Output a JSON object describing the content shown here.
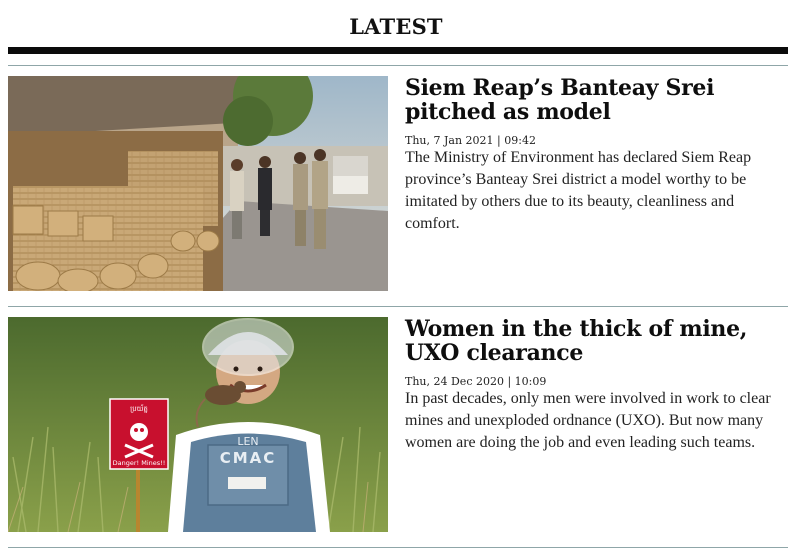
{
  "section": {
    "title": "LATEST"
  },
  "articles": [
    {
      "headline": "Siem Reap’s Banteay Srei pitched as model",
      "date": "Thu, 7 Jan 2021 | 09:42",
      "summary": "The Ministry of Environment has declared Siem Reap province’s Banteay Srei district a model worthy to be imitated by others due to its beauty, cleanliness and comfort.",
      "image_alt": "Officials visiting a roadside stall of woven rattan baskets"
    },
    {
      "headline": "Women in the thick of mine, UXO clearance",
      "date": "Thu, 24 Dec 2020 | 10:09",
      "summary": "In past decades, only men were involved in work to clear mines and unexploded ordnance (UXO). But now many women are doing the job and even leading such teams.",
      "image_alt": "Female deminer in CMAC gear with a rat on her shoulder beside a mine warning sign",
      "sign_text": "Danger! Mines!!",
      "vest_text": "CMAC"
    }
  ],
  "colors": {
    "rule_thin": "#8fa6a8",
    "rule_thick": "#0b0b0b",
    "sign_red": "#c8102e"
  }
}
